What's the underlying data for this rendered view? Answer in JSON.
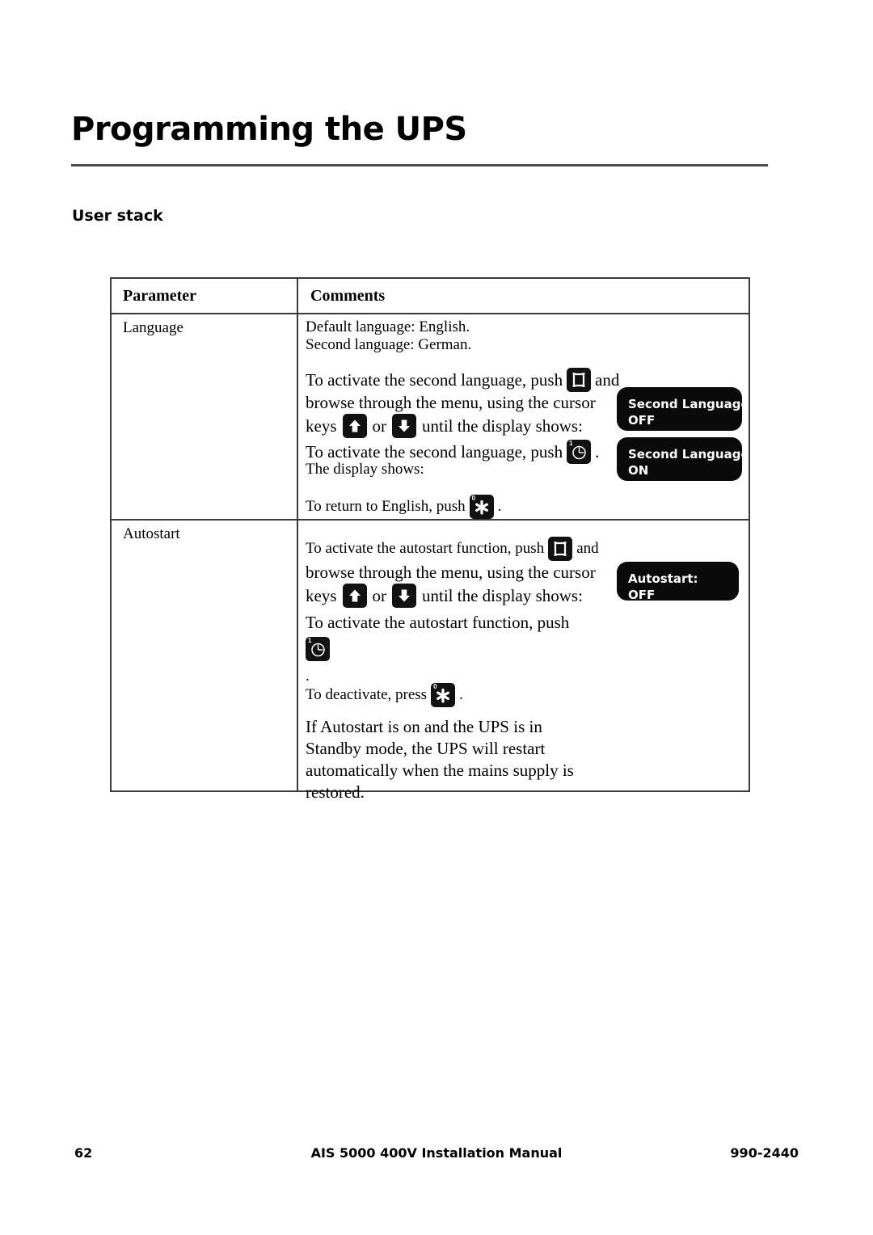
{
  "document": {
    "title": "Programming the UPS",
    "section_title": "User stack"
  },
  "table": {
    "headers": {
      "parameter": "Parameter",
      "comments": "Comments"
    },
    "rows": [
      {
        "parameter": "Language",
        "lines": {
          "default_language": "Default language: English.",
          "second_language": "Second language: German.",
          "activate_prefix": "To activate the second language, push",
          "activate_suffix": "and",
          "browse_line": "browse through the menu, using the cursor",
          "keys_label": "keys",
          "or_label": "or",
          "until_label": "until the display shows:",
          "push_clock_prefix": "To activate the second language, push",
          "push_clock_suffix": ".",
          "display_shows": "The display shows:",
          "return_english_prefix": "To return to English, push",
          "return_english_suffix": "."
        },
        "displays": [
          {
            "line1": "Second Language:",
            "line2": "OFF"
          },
          {
            "line1": "Second Language:",
            "line2": "ON"
          }
        ]
      },
      {
        "parameter": "Autostart",
        "lines": {
          "activate_prefix": "To activate the autostart function, push",
          "activate_suffix": "and",
          "browse_line": "browse through the menu, using the cursor",
          "keys_label": "keys",
          "or_label": "or",
          "until_label": "until the display shows:",
          "push_clock_line": "To activate the autostart function, push",
          "period_line": ".",
          "deactivate_prefix": "To deactivate, press",
          "deactivate_suffix": ".",
          "note_line1": "If Autostart is on and the UPS is in",
          "note_line2": "Standby mode, the UPS will restart",
          "note_line3": "automatically when the mains supply is",
          "note_line4": "restored."
        },
        "displays": [
          {
            "line1": "Autostart:",
            "line2": "OFF"
          }
        ]
      }
    ]
  },
  "keys": {
    "menu_icon": "menu-frame-icon",
    "up_icon": "cursor-up-icon",
    "down_icon": "cursor-down-icon",
    "clock_icon": "clock-power-icon",
    "clock_digit": "1",
    "star_icon": "star-asterisk-icon",
    "star_digit": "0"
  },
  "footer": {
    "page_number": "62",
    "manual_title": "AIS 5000 400V Installation Manual",
    "document_code": "990-2440"
  },
  "colors": {
    "ink": "#000000",
    "rule": "#4d4d4d",
    "key_black": "#121212",
    "lcd_black": "#0a0a0a",
    "lcd_text": "#ffffff"
  }
}
